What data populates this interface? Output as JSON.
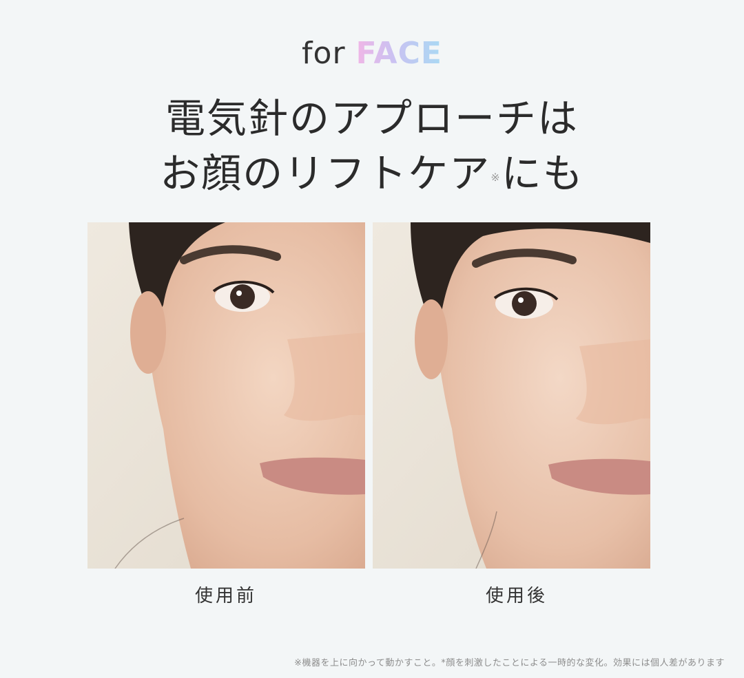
{
  "header": {
    "eyebrow_prefix": "for",
    "eyebrow_brand": "FACE",
    "headline_line1": "電気針のアプローチは",
    "headline_line2_part1": "お顔のリフトケア",
    "headline_mark": "※",
    "headline_line2_part2": "にも"
  },
  "comparison": {
    "before_label": "使用前",
    "after_label": "使用後"
  },
  "footnote": "※機器を上に向かって動かすこと。*顔を刺激したことによる一時的な変化。効果には個人差があります",
  "colors": {
    "background": "#f3f6f7",
    "brand_gradient": [
      "#f0b6e6",
      "#c9c2f2",
      "#a9d9f3"
    ]
  }
}
